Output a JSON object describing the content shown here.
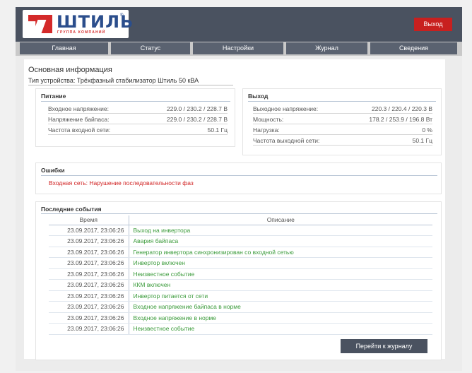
{
  "header": {
    "logo_text": "ШТИЛЬ",
    "logo_sub": "ГРУППА КОМПАНИЙ",
    "logo_reg": "®",
    "exit_label": "Выход"
  },
  "nav": {
    "items": [
      {
        "label": "Главная"
      },
      {
        "label": "Статус"
      },
      {
        "label": "Настройки"
      },
      {
        "label": "Журнал"
      },
      {
        "label": "Сведения"
      }
    ]
  },
  "main": {
    "title": "Основная информация",
    "device": "Тип устройства: Трёхфазный стабилизатор Штиль 50 кВА"
  },
  "power": {
    "title": "Питание",
    "rows": [
      {
        "label": "Входное напряжение:",
        "value": "229.0 / 230.2 / 228.7 В"
      },
      {
        "label": "Напряжение байпаса:",
        "value": "229.0 / 230.2 / 228.7 В"
      },
      {
        "label": "Частота входной сети:",
        "value": "50.1 Гц"
      }
    ]
  },
  "output": {
    "title": "Выход",
    "rows": [
      {
        "label": "Выходное напряжение:",
        "value": "220.3 / 220.4 / 220.3 В"
      },
      {
        "label": "Мощность:",
        "value": "178.2 / 253.9 / 196.8 Вт"
      },
      {
        "label": "Нагрузка:",
        "value": "0 %"
      },
      {
        "label": "Частота выходной сети:",
        "value": "50.1 Гц"
      }
    ]
  },
  "errors": {
    "title": "Ошибки",
    "text": "Входная сеть: Нарушение последовательности фаз"
  },
  "events": {
    "title": "Последние события",
    "col_time": "Время",
    "col_desc": "Описание",
    "rows": [
      {
        "time": "23.09.2017, 23:06:26",
        "desc": "Выход на инвертора"
      },
      {
        "time": "23.09.2017, 23:06:26",
        "desc": "Авария байпаса"
      },
      {
        "time": "23.09.2017, 23:06:26",
        "desc": "Генератор инвертора синхронизирован со входной сетью"
      },
      {
        "time": "23.09.2017, 23:06:26",
        "desc": "Инвертор включен"
      },
      {
        "time": "23.09.2017, 23:06:26",
        "desc": "Неизвестное событие"
      },
      {
        "time": "23.09.2017, 23:06:26",
        "desc": "ККМ включен"
      },
      {
        "time": "23.09.2017, 23:06:26",
        "desc": "Инвертор питается от сети"
      },
      {
        "time": "23.09.2017, 23:06:26",
        "desc": "Входное напряжение байпаса в норме"
      },
      {
        "time": "23.09.2017, 23:06:26",
        "desc": "Входное напряжение в норме"
      },
      {
        "time": "23.09.2017, 23:06:26",
        "desc": "Неизвестное событие"
      }
    ],
    "journal_button": "Перейти к журналу"
  }
}
